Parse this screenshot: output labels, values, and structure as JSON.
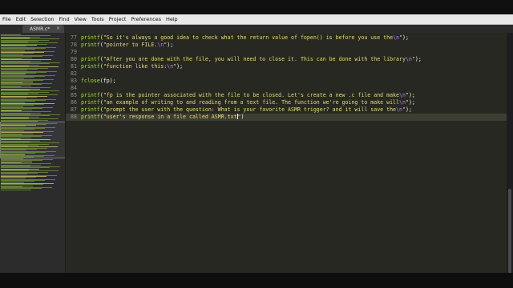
{
  "menu": [
    "File",
    "Edit",
    "Selection",
    "Find",
    "View",
    "Tools",
    "Project",
    "Preferences",
    "Help"
  ],
  "tab": {
    "label": "ASMR.c*",
    "close": "×"
  },
  "colors": {
    "keyword": "#a6e22e",
    "string": "#e6db74",
    "escape": "#ae81ff",
    "background": "#272822"
  },
  "lines": [
    {
      "num": "77",
      "pre": "printf(\"",
      "text": "So it's always a good idea to check what the return value of fopen() is before you use the",
      "esc": "\\n",
      "post": "\");"
    },
    {
      "num": "78",
      "pre": "printf(\"",
      "text": "pointer to FILE.",
      "esc": "\\n",
      "post": "\");"
    },
    {
      "num": "79",
      "pre": "",
      "text": "",
      "esc": "",
      "post": ""
    },
    {
      "num": "80",
      "pre": "printf(\"",
      "text": "After you are done with the file, you will need to close it. This can be done with the library",
      "esc": "\\n",
      "post": "\");"
    },
    {
      "num": "81",
      "pre": "printf(\"",
      "text": "function like this:",
      "esc": "\\n",
      "post": "\");"
    },
    {
      "num": "82",
      "pre": "",
      "text": "",
      "esc": "",
      "post": ""
    },
    {
      "num": "83",
      "pre": "fclose(fp);",
      "text": "",
      "esc": "",
      "post": ""
    },
    {
      "num": "84",
      "pre": "",
      "text": "",
      "esc": "",
      "post": ""
    },
    {
      "num": "85",
      "pre": "printf(\"",
      "text": "fp is the pointer associated with the file to be closed. Let's create a new .c file and make",
      "esc": "\\n",
      "post": "\");"
    },
    {
      "num": "86",
      "pre": "printf(\"",
      "text": "an example of writing to and reading from a text file. The function we're going to make will",
      "esc": "\\n",
      "post": "\");"
    },
    {
      "num": "87",
      "pre": "printf(\"",
      "text": "prompt the user with the question: What is your favorite ASMR trigger? and it will save the",
      "esc": "\\n",
      "post": "\");"
    },
    {
      "num": "88",
      "pre": "printf(\"",
      "text": "user's response in a file called ASMR.txt",
      "esc": "",
      "post": "\")"
    }
  ]
}
